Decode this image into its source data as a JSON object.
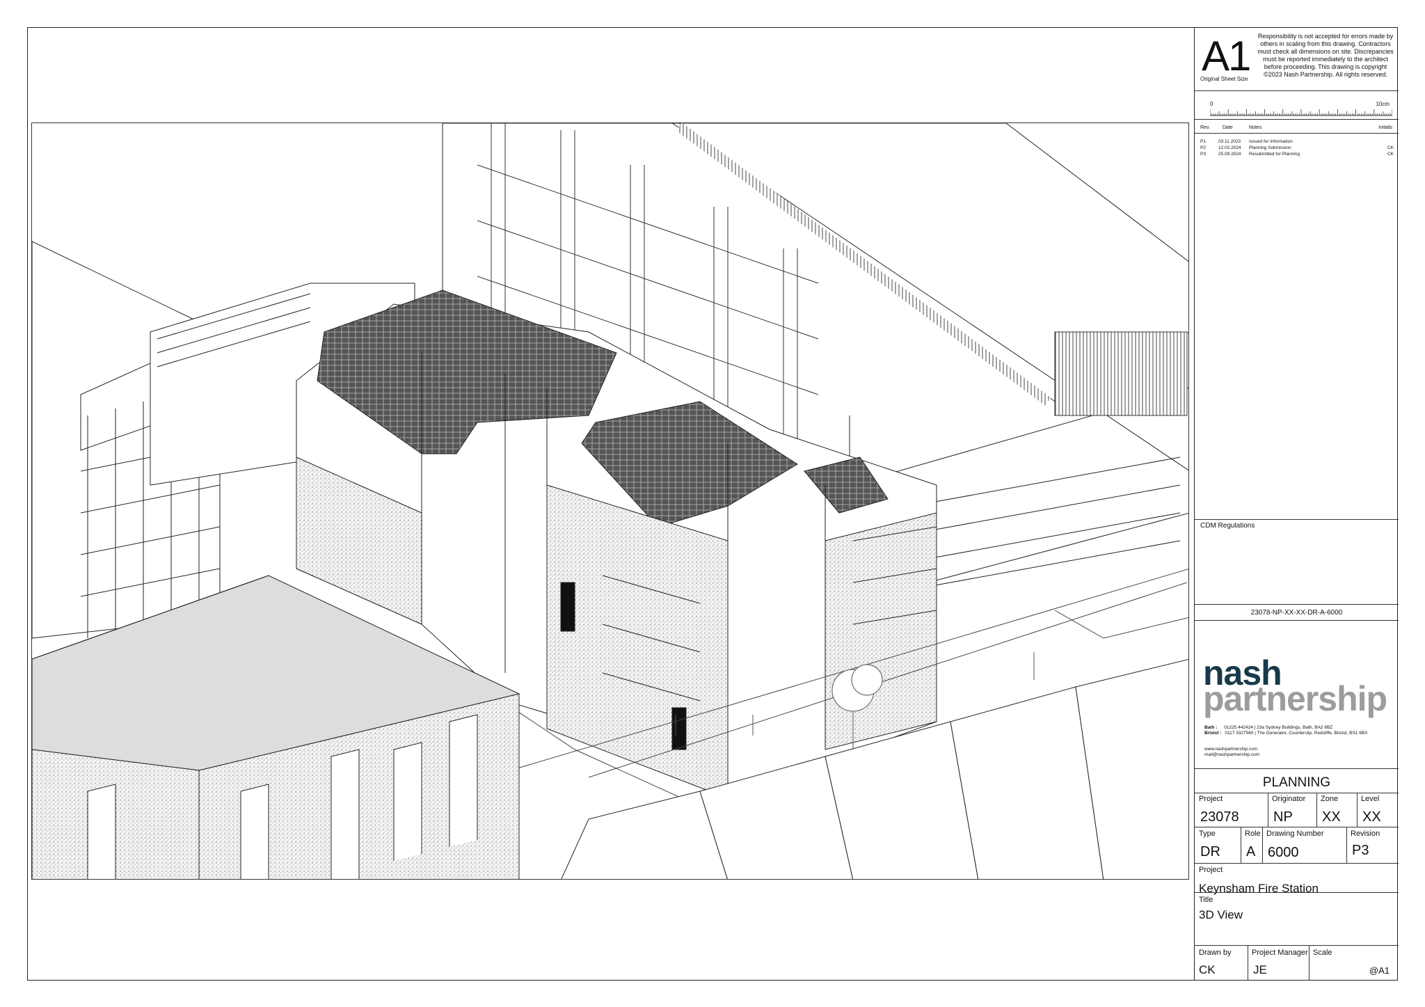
{
  "sheet": {
    "size": "A1",
    "size_caption": "Original Sheet Size",
    "disclaimer": "Responsibility is not accepted for errors made by others in scaling from this drawing. Contractors must check all dimensions on site. Discrepancies must be reported immediately to the architect before proceeding. This drawing is copyright ©2023 Nash Partnership. All rights reserved.",
    "scale_bar_start": "0",
    "scale_bar_end": "10cm"
  },
  "revisions": {
    "headers": {
      "rev": "Rev.",
      "date": "Date",
      "notes": "Notes",
      "initials": "Initials"
    },
    "rows": [
      {
        "rev": "P1",
        "date": "03.11.2023",
        "notes": "Issued for Information",
        "initials": ""
      },
      {
        "rev": "P2",
        "date": "12.02.2024",
        "notes": "Planning Submission",
        "initials": "CK"
      },
      {
        "rev": "P3",
        "date": "25.09.2024",
        "notes": "Resubmitted for Planning",
        "initials": "CK"
      }
    ]
  },
  "cdm": {
    "label": "CDM Regulations"
  },
  "drawing_ref": "23078-NP-XX-XX-DR-A-6000",
  "company": {
    "name_line1": "nash",
    "name_line2": "partnership",
    "brand_dark": "#173a49",
    "brand_grey": "#9c9c9c",
    "bath_label": "Bath :",
    "bath_phone": "01225 442424",
    "bath_address": "23a Sydney Buildings, Bath, BA2 6BZ",
    "bristol_label": "Bristol :",
    "bristol_phone": "0117 3327560",
    "bristol_address": "The Generator, Counterslip, Redcliffe, Bristol, BS1 6BX",
    "web": "www.nashpartnership.com",
    "email": "mail@nashpartnership.com"
  },
  "status": "PLANNING",
  "fields": {
    "project_label": "Project",
    "project_value": "23078",
    "originator_label": "Originator",
    "originator_value": "NP",
    "zone_label": "Zone",
    "zone_value": "XX",
    "level_label": "Level",
    "level_value": "XX",
    "type_label": "Type",
    "type_value": "DR",
    "role_label": "Role",
    "role_value": "A",
    "drawing_number_label": "Drawing Number",
    "drawing_number_value": "6000",
    "revision_label": "Revision",
    "revision_value": "P3",
    "project_name_label": "Project",
    "project_name_value": "Keynsham Fire Station",
    "title_label": "Title",
    "title_value": "3D View",
    "drawn_by_label": "Drawn by",
    "drawn_by_value": "CK",
    "pm_label": "Project Manager",
    "pm_value": "JE",
    "scale_label": "Scale",
    "scale_value": "@A1"
  }
}
